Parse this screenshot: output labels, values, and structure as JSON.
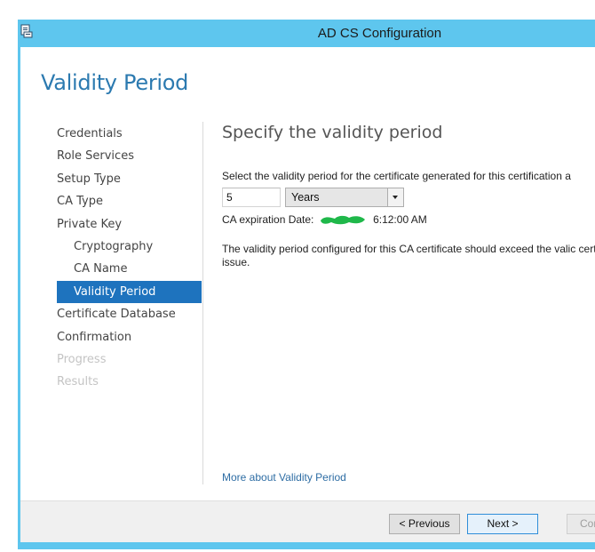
{
  "window": {
    "title": "AD CS Configuration",
    "icon": "server-manager-icon"
  },
  "page": {
    "title": "Validity Period"
  },
  "nav": {
    "items": [
      {
        "label": "Credentials",
        "state": "normal",
        "level": 0
      },
      {
        "label": "Role Services",
        "state": "normal",
        "level": 0
      },
      {
        "label": "Setup Type",
        "state": "normal",
        "level": 0
      },
      {
        "label": "CA Type",
        "state": "normal",
        "level": 0
      },
      {
        "label": "Private Key",
        "state": "normal",
        "level": 0
      },
      {
        "label": "Cryptography",
        "state": "normal",
        "level": 1
      },
      {
        "label": "CA Name",
        "state": "normal",
        "level": 1
      },
      {
        "label": "Validity Period",
        "state": "active",
        "level": 1
      },
      {
        "label": "Certificate Database",
        "state": "normal",
        "level": 0
      },
      {
        "label": "Confirmation",
        "state": "normal",
        "level": 0
      },
      {
        "label": "Progress",
        "state": "disabled",
        "level": 0
      },
      {
        "label": "Results",
        "state": "disabled",
        "level": 0
      }
    ]
  },
  "content": {
    "heading": "Specify the validity period",
    "prompt": "Select the validity period for the certificate generated for this certification a",
    "period_value": "5",
    "period_unit": "Years",
    "expiration_label": "CA expiration Date:",
    "expiration_time": "6:12:00 AM",
    "note": "The validity period configured for this CA certificate should exceed the valic certificates it will issue.",
    "more_link": "More about Validity Period"
  },
  "footer": {
    "previous_label": "< Previous",
    "next_label": "Next >",
    "configure_label": "Cor"
  },
  "colors": {
    "titlebar": "#5ec6ee",
    "accent": "#1e73be",
    "title_text": "#2c7ab0",
    "link": "#2e6da4",
    "redaction": "#1fb84a"
  }
}
